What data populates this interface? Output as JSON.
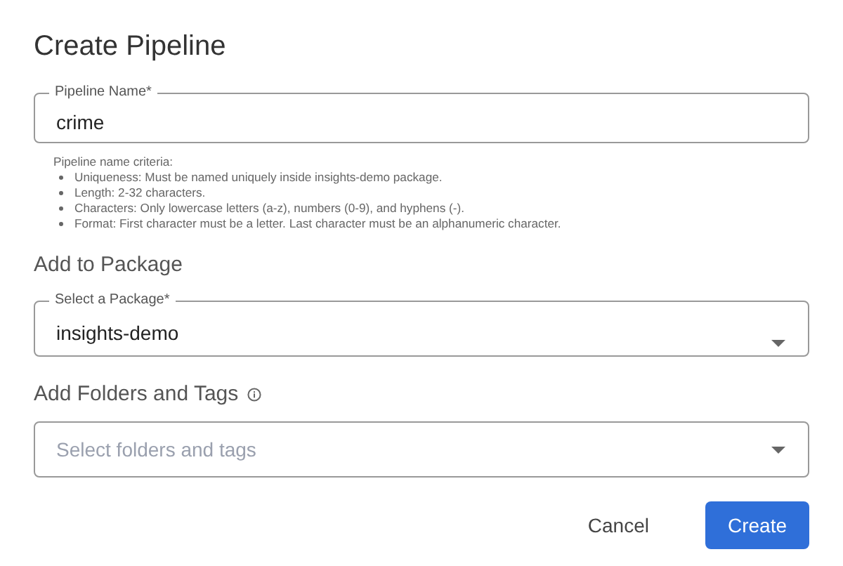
{
  "dialog": {
    "title": "Create Pipeline"
  },
  "name_field": {
    "label": "Pipeline Name*",
    "value": "crime"
  },
  "criteria": {
    "heading": "Pipeline name criteria:",
    "items": [
      "Uniqueness: Must be named uniquely inside insights-demo package.",
      "Length: 2-32 characters.",
      "Characters: Only lowercase letters (a-z), numbers (0-9), and hyphens (-).",
      "Format: First character must be a letter. Last character must be an alphanumeric character."
    ]
  },
  "package_section": {
    "heading": "Add to Package"
  },
  "package_field": {
    "label": "Select a Package*",
    "value": "insights-demo"
  },
  "folders_section": {
    "heading": "Add Folders and Tags"
  },
  "folders_field": {
    "placeholder": "Select folders and tags"
  },
  "buttons": [
    {
      "label": "Cancel",
      "kind": "text"
    },
    {
      "label": "Create",
      "kind": "primary"
    }
  ]
}
